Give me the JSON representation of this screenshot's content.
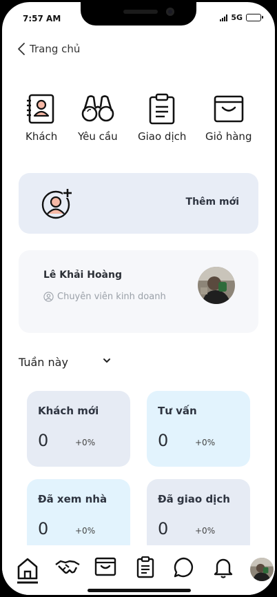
{
  "status": {
    "time": "7:57 AM",
    "network": "5G"
  },
  "header": {
    "back_label": "Trang chủ"
  },
  "quick_actions": [
    {
      "label": "Khách",
      "icon": "contact-book-icon"
    },
    {
      "label": "Yêu cầu",
      "icon": "binoculars-icon"
    },
    {
      "label": "Giao dịch",
      "icon": "clipboard-icon"
    },
    {
      "label": "Giỏ hàng",
      "icon": "inbox-tray-icon"
    }
  ],
  "add_new": {
    "label": "Thêm mới",
    "icon": "add-user-icon"
  },
  "profile": {
    "name": "Lê Khải Hoàng",
    "role": "Chuyên viên kinh doanh"
  },
  "period": {
    "selected": "Tuần này"
  },
  "stats": [
    {
      "title": "Khách mới",
      "value": "0",
      "change": "+0%"
    },
    {
      "title": "Tư vấn",
      "value": "0",
      "change": "+0%"
    },
    {
      "title": "Đã xem nhà",
      "value": "0",
      "change": "+0%"
    },
    {
      "title": "Đã giao dịch",
      "value": "0",
      "change": "+0%"
    }
  ],
  "tabbar": [
    "home-icon",
    "handshake-icon",
    "inbox-tray-icon",
    "clipboard-icon",
    "chat-icon",
    "bell-icon",
    "profile-avatar"
  ],
  "colors": {
    "card_gray": "#e6ebf4",
    "card_blue": "#e2f3fd",
    "text_dark": "#2e3440",
    "muted": "#9aa0a8"
  }
}
